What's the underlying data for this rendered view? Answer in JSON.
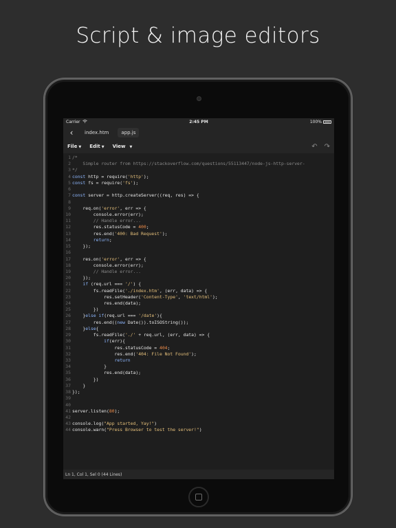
{
  "headline": "Script & image editors",
  "status_bar": {
    "carrier": "Carrier",
    "time": "2:45 PM",
    "battery": "100%"
  },
  "tabs": [
    {
      "label": "index.htm"
    },
    {
      "label": "app.js"
    }
  ],
  "menu": {
    "file": "File",
    "edit": "Edit",
    "view": "View"
  },
  "icons": {
    "back": "chevron-left-icon",
    "undo": "undo-icon",
    "redo": "redo-icon",
    "wifi": "wifi-icon",
    "battery": "battery-icon"
  },
  "code_lines": [
    {
      "n": "1",
      "t": "/*"
    },
    {
      "n": "2",
      "t": "    Simple router from https://stackoverflow.com/questions/55113447/node-js-http-server-"
    },
    {
      "n": "3",
      "t": "*/"
    },
    {
      "n": "4",
      "t": "const http = require('http');"
    },
    {
      "n": "5",
      "t": "const fs = require('fs');"
    },
    {
      "n": "6",
      "t": ""
    },
    {
      "n": "7",
      "t": "const server = http.createServer((req, res) => {"
    },
    {
      "n": "8",
      "t": ""
    },
    {
      "n": "9",
      "t": "    req.on('error', err => {"
    },
    {
      "n": "10",
      "t": "        console.error(err);"
    },
    {
      "n": "11",
      "t": "        // Handle error..."
    },
    {
      "n": "12",
      "t": "        res.statusCode = 400;"
    },
    {
      "n": "13",
      "t": "        res.end('400: Bad Request');"
    },
    {
      "n": "14",
      "t": "        return;"
    },
    {
      "n": "15",
      "t": "    });"
    },
    {
      "n": "16",
      "t": ""
    },
    {
      "n": "17",
      "t": "    res.on('error', err => {"
    },
    {
      "n": "18",
      "t": "        console.error(err);"
    },
    {
      "n": "19",
      "t": "        // Handle error..."
    },
    {
      "n": "20",
      "t": "    });"
    },
    {
      "n": "21",
      "t": "    if (req.url === '/') {"
    },
    {
      "n": "22",
      "t": "        fs.readFile('./index.htm', (err, data) => {"
    },
    {
      "n": "23",
      "t": "            res.setHeader('Content-Type', 'text/html');"
    },
    {
      "n": "24",
      "t": "            res.end(data);"
    },
    {
      "n": "25",
      "t": "        })"
    },
    {
      "n": "26",
      "t": "    }else if(req.url === '/date'){"
    },
    {
      "n": "27",
      "t": "        res.end((new Date()).toISOString());"
    },
    {
      "n": "28",
      "t": "    }else{"
    },
    {
      "n": "29",
      "t": "        fs.readFile('./' + req.url, (err, data) => {"
    },
    {
      "n": "30",
      "t": "            if(err){"
    },
    {
      "n": "31",
      "t": "                res.statusCode = 404;"
    },
    {
      "n": "32",
      "t": "                res.end('404: File Not Found');"
    },
    {
      "n": "33",
      "t": "                return"
    },
    {
      "n": "34",
      "t": "            }"
    },
    {
      "n": "35",
      "t": "            res.end(data);"
    },
    {
      "n": "36",
      "t": "        })"
    },
    {
      "n": "37",
      "t": "    }"
    },
    {
      "n": "38",
      "t": "});"
    },
    {
      "n": "39",
      "t": ""
    },
    {
      "n": "40",
      "t": ""
    },
    {
      "n": "41",
      "t": "server.listen(80);"
    },
    {
      "n": "42",
      "t": ""
    },
    {
      "n": "43",
      "t": "console.log(\"App started, Yay!\")"
    },
    {
      "n": "44",
      "t": "console.warn(\"Press Browser to test the server!\")"
    }
  ],
  "footer": "Ln 1, Col 1, Sel 0 (44 Lines)"
}
